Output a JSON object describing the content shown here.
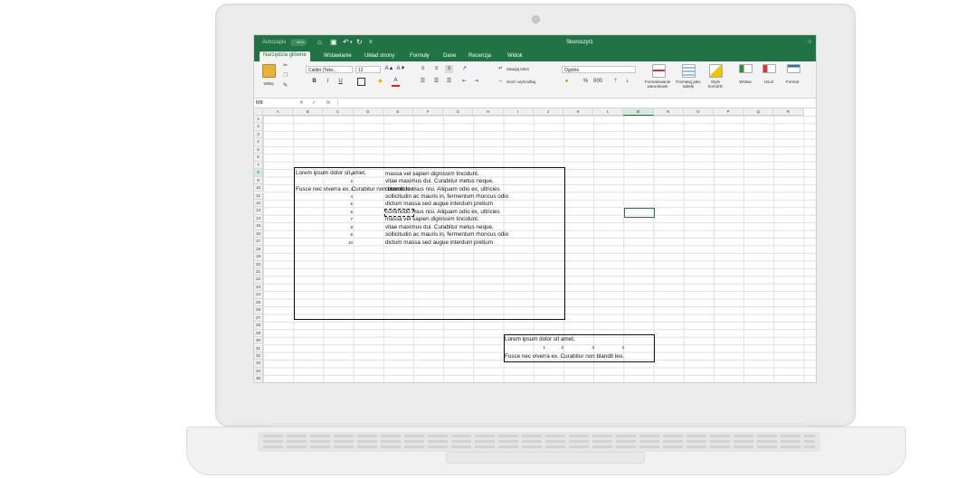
{
  "window": {
    "title": "Skoroszyt1",
    "autosave_label": "Autozapis",
    "autosave_state": "WYŁ."
  },
  "ribbon": {
    "tabs": [
      "Narzędzia główne",
      "Wstawianie",
      "Układ strony",
      "Formuły",
      "Dane",
      "Recenzja",
      "Widok"
    ],
    "active_tab": "Narzędzia główne",
    "paste_label": "Wklej",
    "font_name": "Calibri (Teks...",
    "font_size": "12",
    "wrap_text_label": "Zawijaj tekst",
    "merge_label": "Scal i wyśrodkuj",
    "number_format": "Ogólne",
    "conditional_format_label": "Formatowanie warunkowe",
    "format_as_table_label": "Formatuj jako tabelę",
    "cell_styles_label": "Style komórki",
    "insert_label": "Wstaw",
    "delete_label": "Usuń",
    "format_label": "Format",
    "bold": "B",
    "italic": "I",
    "underline": "U",
    "percent": "%",
    "thousands": "000",
    "font_color_letter": "A",
    "grow_font": "A▲",
    "shrink_font": "A▼"
  },
  "formula_bar": {
    "name_box": "M8",
    "fx": "fx",
    "cancel": "✕",
    "confirm": "✓"
  },
  "columns": [
    "A",
    "B",
    "C",
    "D",
    "E",
    "F",
    "G",
    "H",
    "I",
    "J",
    "K",
    "L",
    "M",
    "N",
    "O",
    "P",
    "Q",
    "R"
  ],
  "active_column": "M",
  "rows": [
    "1",
    "2",
    "3",
    "4",
    "5",
    "6",
    "7",
    "8",
    "9",
    "10",
    "11",
    "12",
    "13",
    "14",
    "15",
    "16",
    "17",
    "18",
    "19",
    "20",
    "21",
    "22",
    "23",
    "24",
    "25",
    "26",
    "27",
    "28",
    "29",
    "30",
    "31",
    "32",
    "33",
    "34",
    "35"
  ],
  "active_row": "8",
  "sheet": {
    "block1_line1": "Lorem ipsum dolor sit amet,",
    "block1_line2": "Fusce nec viverra ex. Curabitur non blandit leo.",
    "list_numbers": [
      "1",
      "2",
      "3",
      "4",
      "5",
      "6",
      "7",
      "8",
      "9",
      "10"
    ],
    "list_texts": [
      "massa vel sapien dignissim tincidunt.",
      "vitae maximus dui. Curabitur metus neque,",
      "commodo risus nisi. Aliquam odio ex, ultricies",
      "sollicitudin ac mauris in, fermentum rhoncus odio",
      "dictum massa sed augue interdum pretium",
      "commodo risus nisi. Aliquam odio ex, ultricies",
      "massa vel sapien dignissim tincidunt.",
      "vitae maximus dui. Curabitur metus neque,",
      "sollicitudin ac mauris in, fermentum rhoncus odio",
      "dictum massa sed augue interdum pretium"
    ],
    "block2_line1": "Lorem ipsum dolor sit amet,",
    "block2_numbers": [
      "1",
      "2",
      "3",
      "4"
    ],
    "block2_line3": "Fusce nec viverra ex. Curabitur non blandit leo."
  },
  "colors": {
    "excel_green": "#217346",
    "ribbon_bg": "#f3f3f3"
  }
}
